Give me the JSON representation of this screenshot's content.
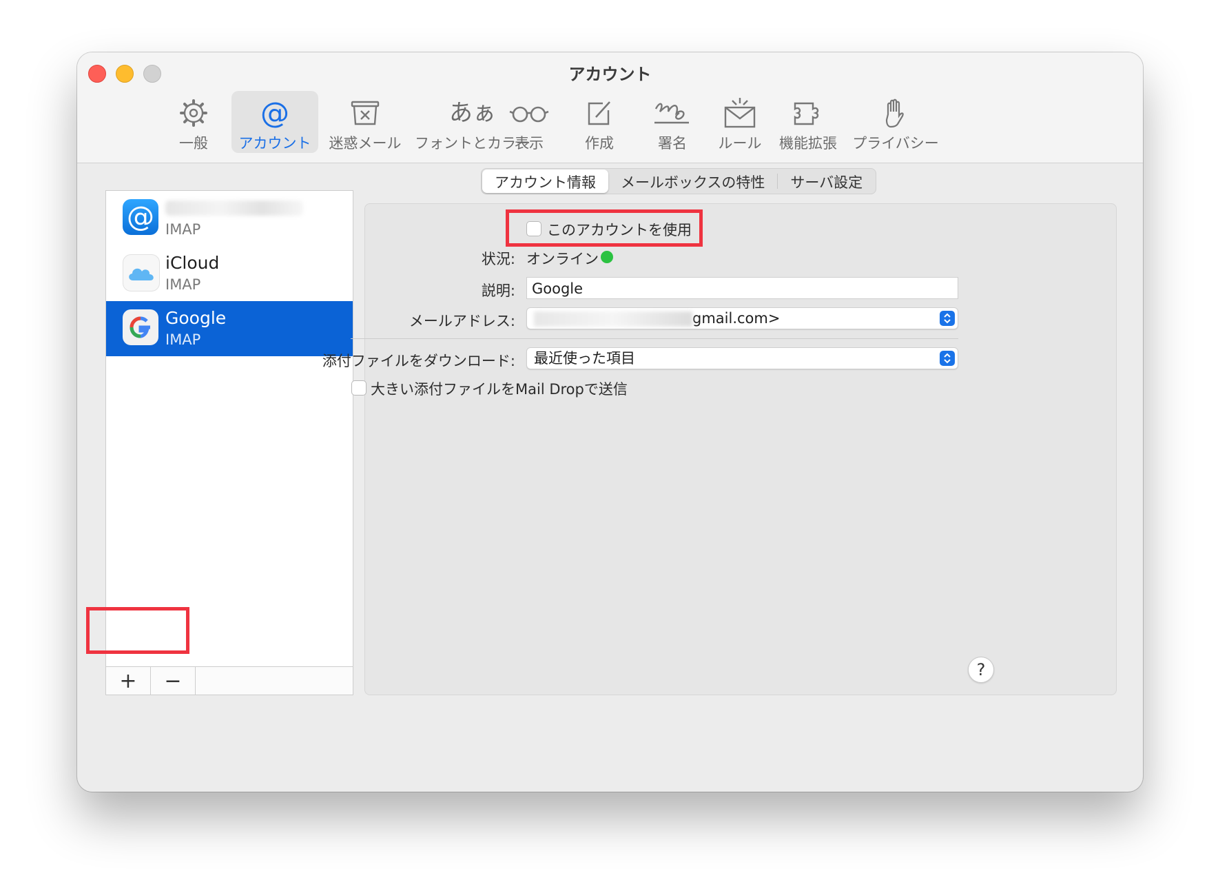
{
  "window": {
    "title": "アカウント"
  },
  "toolbar": {
    "items": [
      {
        "label": "一般",
        "icon": "gear-icon"
      },
      {
        "label": "アカウント",
        "icon": "at-sign-icon",
        "active": true
      },
      {
        "label": "迷惑メール",
        "icon": "junk-tray-icon"
      },
      {
        "label": "フォントとカラー",
        "icon": "fonts-aa-icon",
        "glyph": "あぁ"
      },
      {
        "label": "表示",
        "icon": "glasses-icon"
      },
      {
        "label": "作成",
        "icon": "compose-icon"
      },
      {
        "label": "署名",
        "icon": "signature-icon"
      },
      {
        "label": "ルール",
        "icon": "rules-envelope-icon"
      },
      {
        "label": "機能拡張",
        "icon": "puzzle-icon"
      },
      {
        "label": "プライバシー",
        "icon": "hand-icon"
      }
    ]
  },
  "sidebar": {
    "accounts": [
      {
        "name": "",
        "type": "IMAP",
        "icon": "at-sign-icon"
      },
      {
        "name": "iCloud",
        "type": "IMAP",
        "icon": "icloud-icon"
      },
      {
        "name": "Google",
        "type": "IMAP",
        "icon": "google-icon",
        "selected": true
      }
    ],
    "add_label": "+",
    "remove_label": "−"
  },
  "tabs": [
    {
      "label": "アカウント情報",
      "active": true
    },
    {
      "label": "メールボックスの特性"
    },
    {
      "label": "サーバ設定"
    }
  ],
  "form": {
    "enable_label": "このアカウントを使用",
    "enable_checked": false,
    "status_label": "状況:",
    "status_value": "オンライン",
    "status_color": "#2bc241",
    "description_label": "説明:",
    "description_value": "Google",
    "email_label": "メールアドレス:",
    "email_value": "gmail.com>",
    "download_label": "添付ファイルをダウンロード:",
    "download_value": "最近使った項目",
    "maildrop_label": "大きい添付ファイルをMail Dropで送信",
    "maildrop_checked": false
  },
  "help_label": "?",
  "colors": {
    "accent": "#0b63d6",
    "highlight": "#ef3340",
    "online": "#2bc241"
  }
}
